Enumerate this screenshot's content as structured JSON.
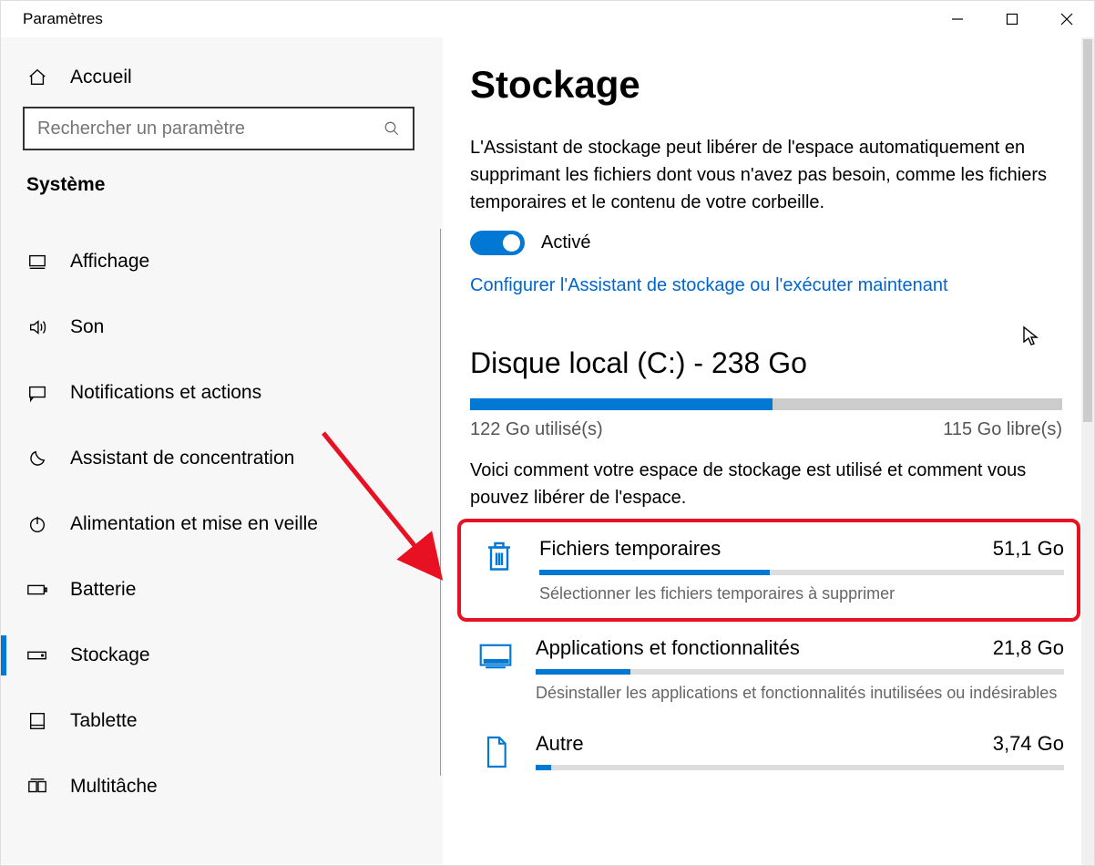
{
  "window": {
    "title": "Paramètres"
  },
  "sidebar": {
    "home_label": "Accueil",
    "search_placeholder": "Rechercher un paramètre",
    "section": "Système",
    "items": [
      {
        "label": "Affichage",
        "icon": "monitor"
      },
      {
        "label": "Son",
        "icon": "speaker"
      },
      {
        "label": "Notifications et actions",
        "icon": "message"
      },
      {
        "label": "Assistant de concentration",
        "icon": "moon"
      },
      {
        "label": "Alimentation et mise en veille",
        "icon": "power"
      },
      {
        "label": "Batterie",
        "icon": "battery"
      },
      {
        "label": "Stockage",
        "icon": "drive"
      },
      {
        "label": "Tablette",
        "icon": "tablet"
      },
      {
        "label": "Multitâche",
        "icon": "multitask"
      }
    ],
    "active_index": 6
  },
  "main": {
    "title": "Stockage",
    "desc": "L'Assistant de stockage peut libérer de l'espace automatiquement en supprimant les fichiers dont vous n'avez pas besoin, comme les fichiers temporaires et le contenu de votre corbeille.",
    "toggle_label": "Activé",
    "toggle_on": true,
    "config_link": "Configurer l'Assistant de stockage ou l'exécuter maintenant",
    "disk": {
      "heading": "Disque local (C:) - 238 Go",
      "used_pct": 51,
      "used_label": "122 Go utilisé(s)",
      "free_label": "115 Go libre(s)",
      "subdesc": "Voici comment votre espace de stockage est utilisé et comment vous pouvez libérer de l'espace."
    },
    "categories": [
      {
        "name": "Fichiers temporaires",
        "size": "51,1 Go",
        "fill_pct": 44,
        "hint": "Sélectionner les fichiers temporaires à supprimer",
        "icon": "trash",
        "highlight": true
      },
      {
        "name": "Applications et fonctionnalités",
        "size": "21,8 Go",
        "fill_pct": 18,
        "hint": "Désinstaller les applications et fonctionnalités inutilisées ou indésirables",
        "icon": "apps",
        "highlight": false
      },
      {
        "name": "Autre",
        "size": "3,74 Go",
        "fill_pct": 3,
        "hint": "",
        "icon": "file",
        "highlight": false
      }
    ]
  }
}
